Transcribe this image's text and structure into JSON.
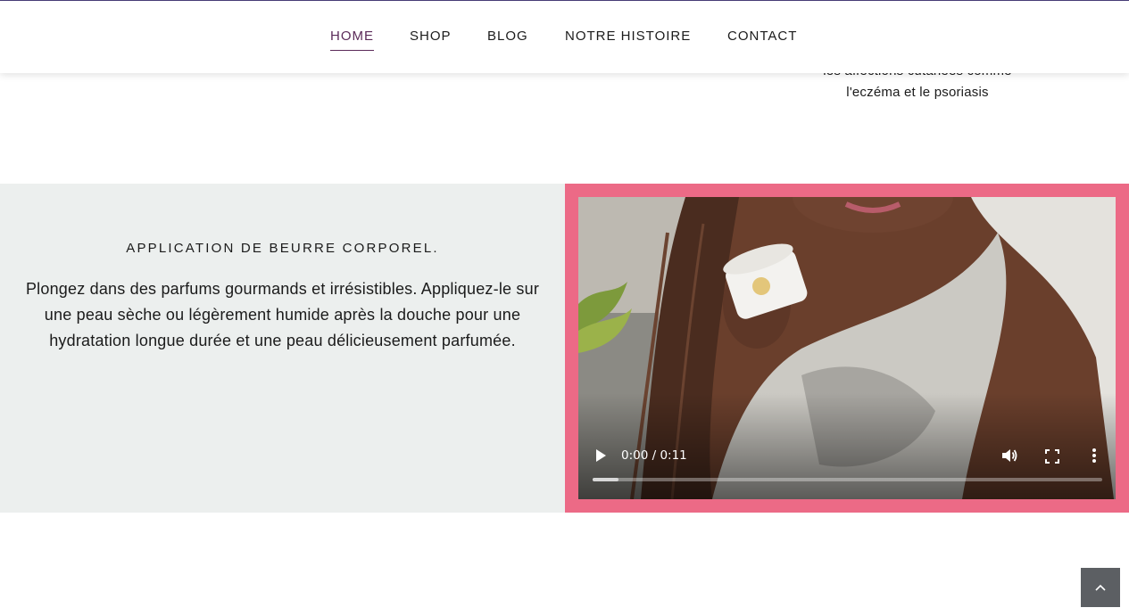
{
  "nav": {
    "items": [
      {
        "label": "HOME",
        "active": true
      },
      {
        "label": "SHOP",
        "active": false
      },
      {
        "label": "BLOG",
        "active": false
      },
      {
        "label": "NOTRE HISTOIRE",
        "active": false
      },
      {
        "label": "CONTACT",
        "active": false
      }
    ],
    "active_color": "#5b2b59"
  },
  "above_section": {
    "text_line_1": "les affections cutanées comme",
    "text_line_2": "l'eczéma et le psoriasis"
  },
  "feature": {
    "title": "APPLICATION DE BEURRE CORPOREL.",
    "body": "Plongez dans des parfums gourmands et irrésistibles. Appliquez-le sur une peau sèche ou légèrement humide après la douche pour une hydratation longue durée et une peau délicieusement parfumée.",
    "panel_color": "#ecefee",
    "frame_color": "#ec6a86"
  },
  "video_player": {
    "time_display": "0:00 / 0:11",
    "progress_fraction": 0.05,
    "icons": [
      "play-icon",
      "volume-icon",
      "fullscreen-icon",
      "more-options-icon"
    ]
  },
  "scroll_top": {
    "icon": "chevron-up-icon"
  }
}
